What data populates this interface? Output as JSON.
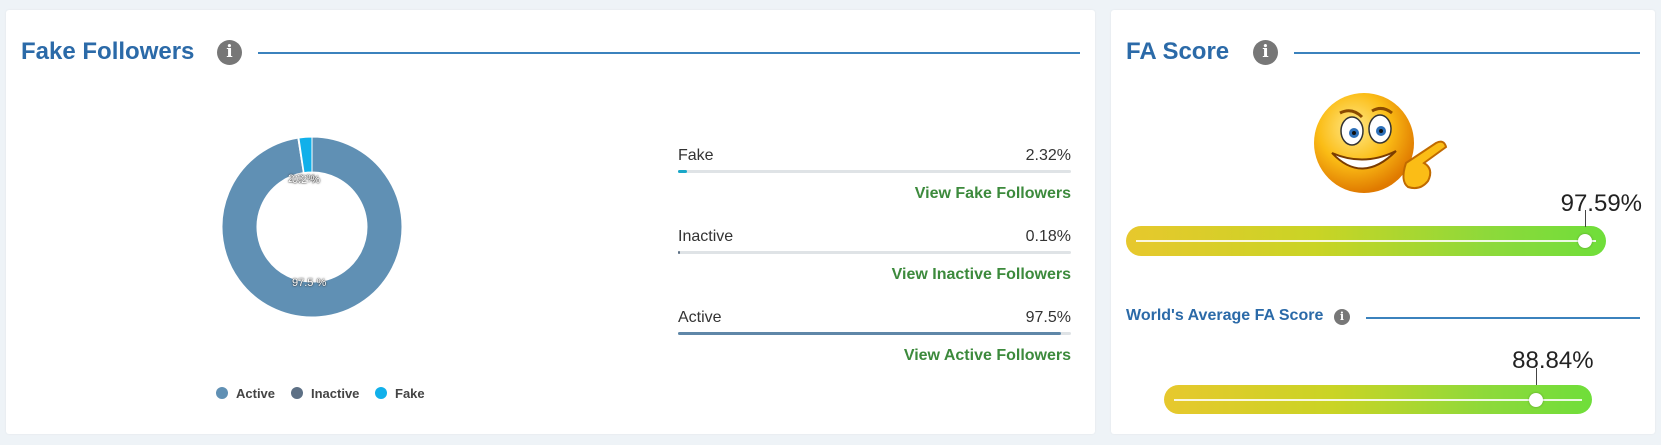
{
  "fake_followers": {
    "title": "Fake Followers",
    "info_icon": "info-icon",
    "donut_labels": {
      "fake": "2.3 %",
      "inactive": "0.2 %",
      "active": "97.5 %"
    },
    "legend": [
      {
        "label": "Active",
        "color": "#6090b4"
      },
      {
        "label": "Inactive",
        "color": "#5d7085"
      },
      {
        "label": "Fake",
        "color": "#11b0ea"
      }
    ],
    "stats": [
      {
        "name": "Fake",
        "value": "2.32%",
        "fraction": 0.0232,
        "color": "#19a7c8",
        "link": "View Fake Followers"
      },
      {
        "name": "Inactive",
        "value": "0.18%",
        "fraction": 0.0018,
        "color": "#5d7085",
        "link": "View Inactive Followers"
      },
      {
        "name": "Active",
        "value": "97.5%",
        "fraction": 0.975,
        "color": "#5f87a8",
        "link": "View Active Followers"
      }
    ]
  },
  "chart_data": {
    "type": "pie",
    "categories": [
      "Active",
      "Inactive",
      "Fake"
    ],
    "values": [
      97.5,
      0.18,
      2.32
    ],
    "colors": [
      "#6090b4",
      "#5d7085",
      "#11b0ea"
    ],
    "legend": "bottom"
  },
  "fa_score": {
    "title": "FA Score",
    "info_icon": "info-icon",
    "emoji": "smiley-thumbs-up-emoji",
    "score": "97.59%",
    "score_fraction": 0.9759,
    "world_title": "World's Average FA Score",
    "world_score": "88.84%",
    "world_fraction": 0.8884
  }
}
